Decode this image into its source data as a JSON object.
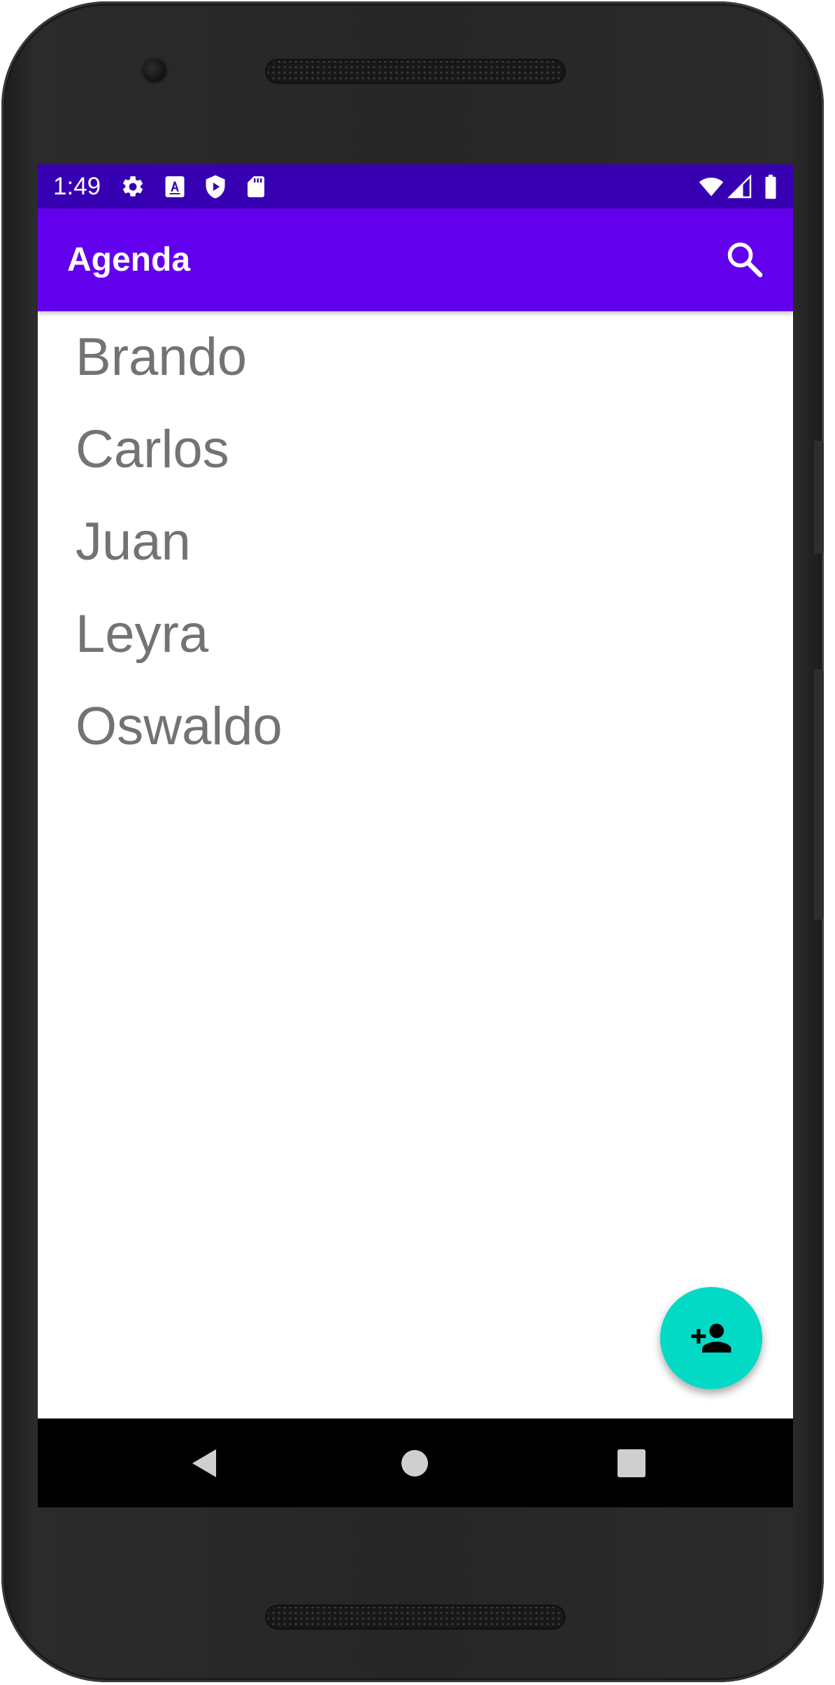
{
  "status_bar": {
    "time": "1:49",
    "left_icons": [
      "settings-icon",
      "keyboard-a-icon",
      "play-protect-icon",
      "sd-card-icon"
    ],
    "right_icons": [
      "wifi-icon",
      "signal-icon",
      "battery-icon"
    ],
    "color": "#3700b3"
  },
  "app_bar": {
    "title": "Agenda",
    "action_icon": "search-icon",
    "color": "#6200ee"
  },
  "contacts": [
    {
      "name": "Brando"
    },
    {
      "name": "Carlos"
    },
    {
      "name": "Juan"
    },
    {
      "name": "Leyra"
    },
    {
      "name": "Oswaldo"
    }
  ],
  "fab": {
    "icon": "add-person-icon",
    "color": "#03dac5"
  },
  "nav_bar": {
    "buttons": [
      "back-icon",
      "home-icon",
      "recents-icon"
    ]
  },
  "colors": {
    "list_text": "#737373",
    "surface": "#ffffff"
  }
}
